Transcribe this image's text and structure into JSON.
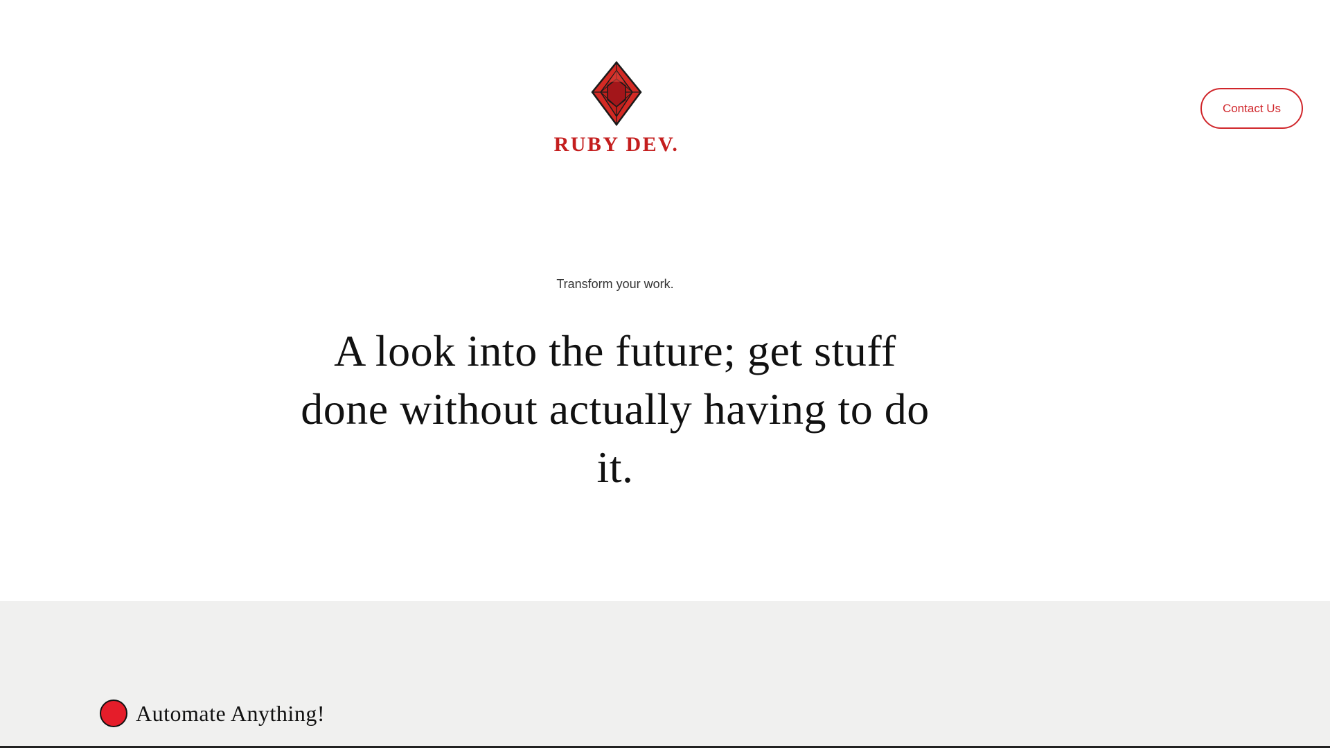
{
  "header": {
    "logo_text": "RUBY DEV.",
    "logo_icon": "ruby-gem-icon",
    "contact_label": "Contact Us"
  },
  "hero": {
    "eyebrow": "Transform your work.",
    "title": "A look into the future; get stuff done without actually having to do it."
  },
  "features": {
    "items": [
      {
        "label": "Automate Anything!",
        "icon": "red-dot-icon"
      }
    ]
  },
  "colors": {
    "brand_red": "#c41e1e",
    "button_red": "#d0262b",
    "dot_red": "#e51d2a",
    "section_grey": "#f0f0ef",
    "background": "#ffffff"
  }
}
